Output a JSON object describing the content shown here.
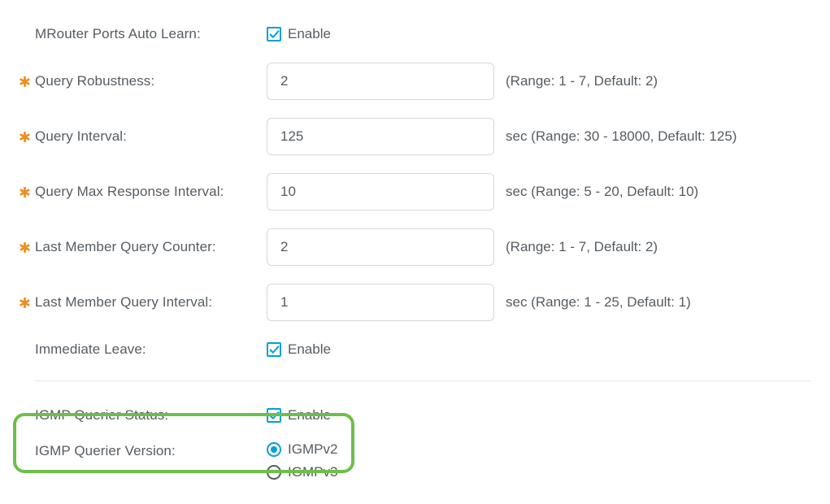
{
  "fields": {
    "mrouter": {
      "label": "MRouter Ports Auto Learn:",
      "enable": "Enable"
    },
    "queryRobustness": {
      "label": "Query Robustness:",
      "value": "2",
      "hint": "(Range: 1 - 7, Default: 2)"
    },
    "queryInterval": {
      "label": "Query Interval:",
      "value": "125",
      "hint": "sec (Range: 30 - 18000, Default: 125)"
    },
    "queryMaxResponse": {
      "label": "Query Max Response Interval:",
      "value": "10",
      "hint": "sec (Range: 5 - 20, Default: 10)"
    },
    "lastMemberCounter": {
      "label": "Last Member Query Counter:",
      "value": "2",
      "hint": "(Range: 1 - 7, Default: 2)"
    },
    "lastMemberInterval": {
      "label": "Last Member Query Interval:",
      "value": "1",
      "hint": "sec (Range: 1 - 25, Default: 1)"
    },
    "immediateLeave": {
      "label": "Immediate Leave:",
      "enable": "Enable"
    },
    "querierStatus": {
      "label": "IGMP Querier Status:",
      "enable": "Enable"
    },
    "querierVersion": {
      "label": "IGMP Querier Version:",
      "options": {
        "v2": "IGMPv2",
        "v3": "IGMPv3"
      }
    }
  },
  "colors": {
    "accent": "#049fd9",
    "required": "#ee8f1c",
    "highlight": "#6cbf4b"
  }
}
